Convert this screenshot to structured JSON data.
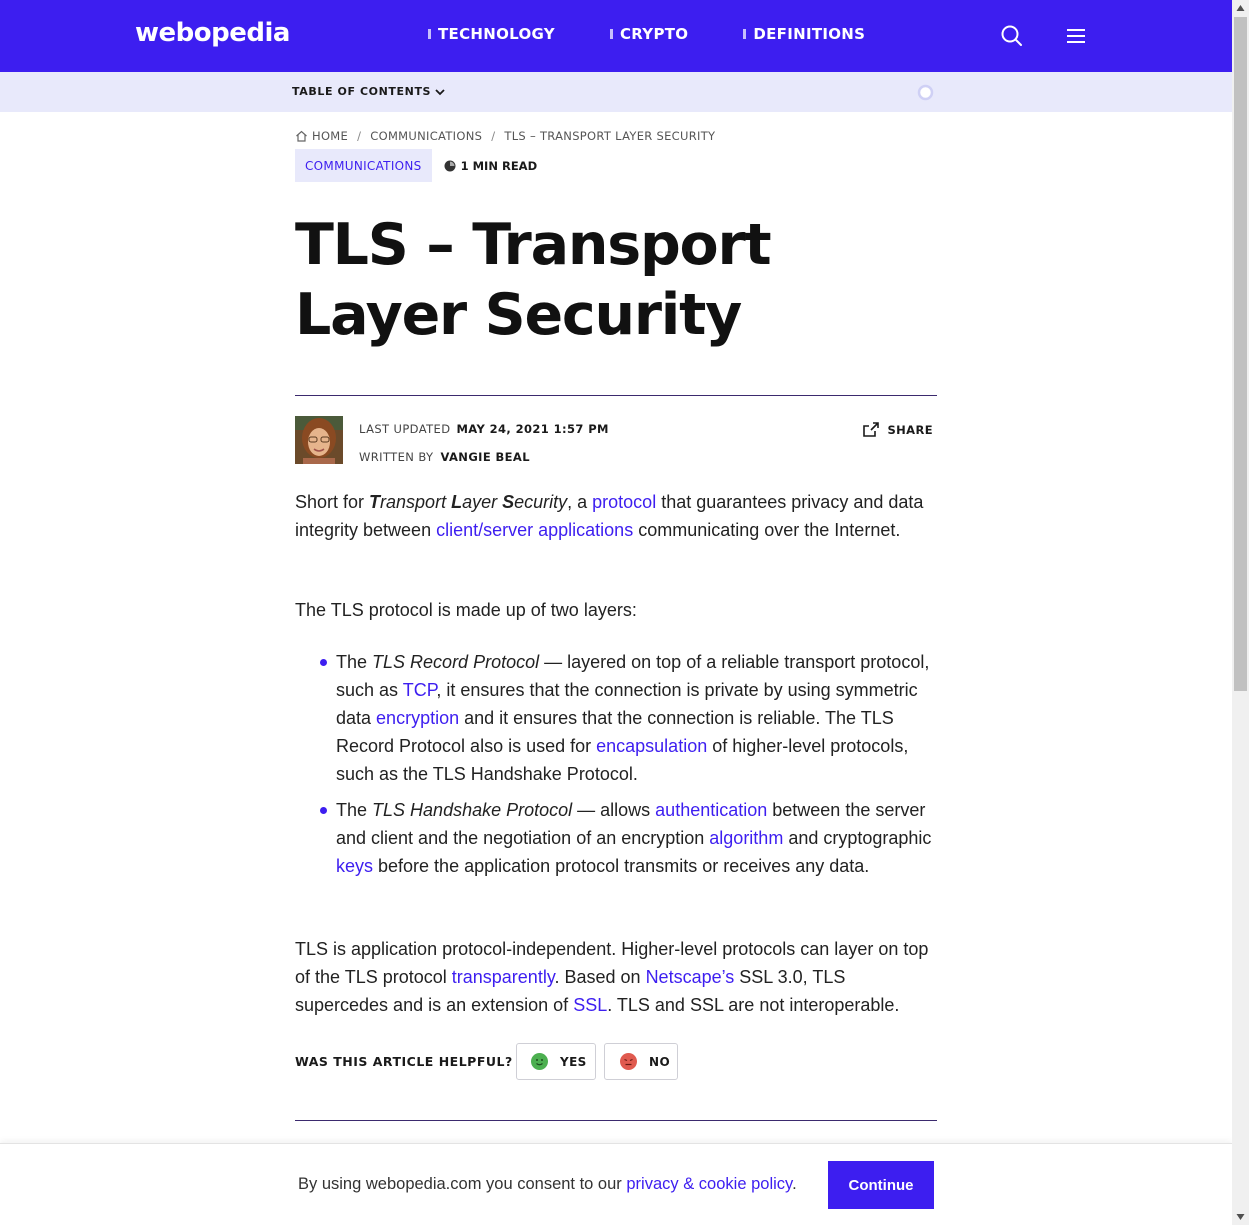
{
  "header": {
    "logo": "webopedia",
    "nav": [
      {
        "label": "TECHNOLOGY"
      },
      {
        "label": "CRYPTO"
      },
      {
        "label": "DEFINITIONS"
      }
    ],
    "search_icon": "search-icon",
    "menu_icon": "hamburger-menu-icon",
    "bg_color": "#3d1ef0"
  },
  "toc": {
    "label": "TABLE OF CONTENTS",
    "reading_progress": 0
  },
  "breadcrumb": {
    "home": "HOME",
    "category": "COMMUNICATIONS",
    "current": "TLS – TRANSPORT LAYER SECURITY"
  },
  "article": {
    "category_badge": "COMMUNICATIONS",
    "read_time": "1 MIN READ",
    "title": "TLS – Transport Layer Security",
    "updated_label": "LAST UPDATED",
    "updated_date": "MAY 24, 2021 1:57 PM",
    "written_label": "WRITTEN BY",
    "author": "VANGIE BEAL",
    "share_label": "SHARE",
    "p1": {
      "t1": "Short for ",
      "t_T": "T",
      "t_ransport": "ransport ",
      "t_L": "L",
      "t_ayer": "ayer ",
      "t_S": "S",
      "t_ecurity": "ecurity",
      "t2": ", a ",
      "link_protocol": "protocol",
      "t3": " that guarantees privacy and data integrity between ",
      "link_clientserver": "client/server applications",
      "t4": " communicating over the Internet."
    },
    "p2": "The TLS protocol is made up of two layers:",
    "bullet1": {
      "t1": "The ",
      "em": "TLS Record Protocol",
      "t2": " — layered on top of a reliable transport protocol, such as ",
      "link_tcp": "TCP",
      "t3": ", it ensures that the connection is private by using symmetric data ",
      "link_encryption": "encryption",
      "t4": " and it ensures that the connection is reliable. The TLS Record Protocol also is used for ",
      "link_encapsulation": "encapsulation",
      "t5": " of higher-level protocols, such as the TLS Handshake Protocol."
    },
    "bullet2": {
      "t1": "The ",
      "em": "TLS Handshake Protocol",
      "t2": " — allows ",
      "link_authentication": "authentication",
      "t3": " between the server and client and the negotiation of an encryption ",
      "link_algorithm": "algorithm",
      "t4": " and cryptographic ",
      "link_keys": "keys",
      "t5": " before the application protocol transmits or receives any data."
    },
    "p3": {
      "t1": "TLS is application protocol-independent. Higher-level protocols can layer on top of the TLS protocol ",
      "link_transparently": "transparently",
      "t2": ". Based on ",
      "link_netscape": "Netscape’s",
      "t3": " SSL 3.0, TLS supercedes and is an extension of ",
      "link_ssl": "SSL",
      "t4": ". TLS and SSL are not interoperable."
    },
    "helpful_label": "WAS THIS ARTICLE HELPFUL?",
    "yes_label": "YES",
    "no_label": "NO"
  },
  "cookie": {
    "text": "By using webopedia.com you consent to our ",
    "link": "privacy & cookie policy",
    "end": ".",
    "button": "Continue"
  },
  "colors": {
    "accent": "#3d1ef0",
    "toc_bg": "#e8e9fb",
    "yes": "#4caf50",
    "no": "#e05a4f"
  }
}
